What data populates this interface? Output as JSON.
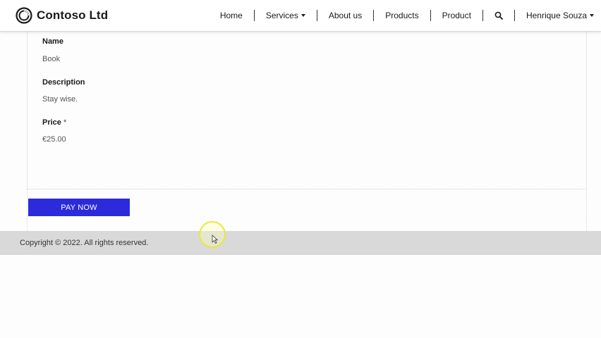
{
  "header": {
    "brand": "Contoso Ltd",
    "nav": [
      {
        "label": "Home"
      },
      {
        "label": "Services"
      },
      {
        "label": "About us"
      },
      {
        "label": "Products"
      },
      {
        "label": "Product"
      }
    ],
    "user": "Henrique Souza"
  },
  "form": {
    "name_label": "Name",
    "name_value": "Book",
    "description_label": "Description",
    "description_value": "Stay wise.",
    "price_label": "Price",
    "price_required_marker": "*",
    "price_value": "€25.00",
    "pay_button": "PAY NOW"
  },
  "footer": {
    "copyright": "Copyright © 2022. All rights reserved."
  },
  "colors": {
    "button": "#2b2bdc",
    "footer_bg": "#d9d9d9",
    "cursor_highlight": "#e8e83a"
  },
  "icons": {
    "brand": "ring-logo-icon",
    "search": "search-icon",
    "dropdown": "caret-down-icon",
    "cursor": "mouse-pointer-icon"
  }
}
